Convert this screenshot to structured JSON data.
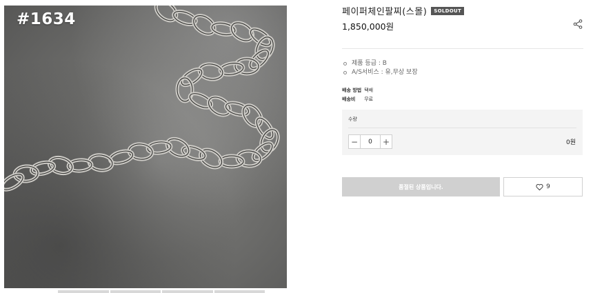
{
  "photo": {
    "tag": "#1634"
  },
  "product": {
    "title": "페이퍼체인팔찌(스몰)",
    "badge": "SOLDOUT",
    "price": "1,850,000원",
    "share_icon": "share-icon"
  },
  "specs": [
    {
      "label": "제품 등급 : B"
    },
    {
      "label": "A/S서비스 :  유,무상 보장"
    }
  ],
  "shipping": {
    "method_label": "배송 방법",
    "method_value": "택배",
    "fee_label": "배송비",
    "fee_value": "무료"
  },
  "quantity": {
    "label": "수량",
    "minus": "−",
    "value": "0",
    "plus": "+",
    "subtotal": "0원"
  },
  "actions": {
    "soldout_label": "품절된 상품입니다.",
    "wish_icon": "heart-icon",
    "wish_count": "9"
  },
  "colors": {
    "badge_bg": "#555555",
    "soldout_bg": "#d0d0d0",
    "qty_panel_bg": "#f4f4f4"
  }
}
